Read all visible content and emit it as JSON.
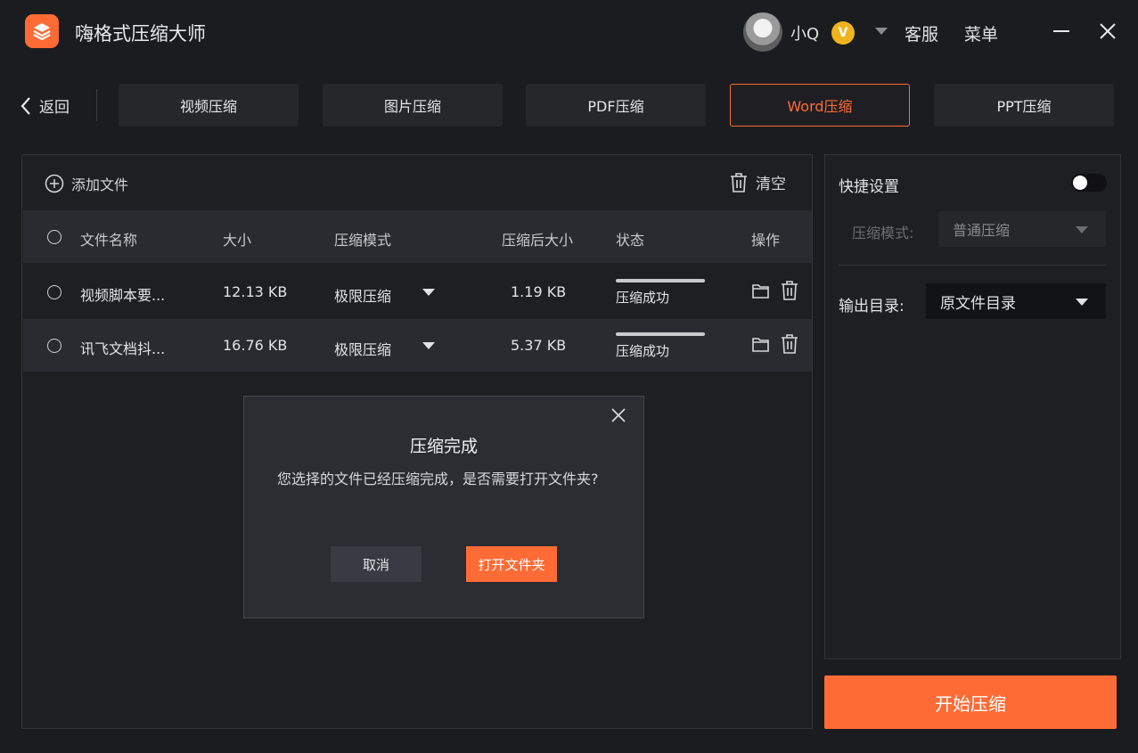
{
  "app": {
    "title": "嗨格式压缩大师",
    "accent": "#ff6b35"
  },
  "user": {
    "name": "小Q",
    "vip_badge": "V"
  },
  "topnav": {
    "service": "客服",
    "menu": "菜单"
  },
  "back": {
    "label": "返回"
  },
  "tabs": [
    {
      "label": "视频压缩"
    },
    {
      "label": "图片压缩"
    },
    {
      "label": "PDF压缩"
    },
    {
      "label": "Word压缩"
    },
    {
      "label": "PPT压缩"
    }
  ],
  "active_tab": "Word压缩",
  "filelist": {
    "add_file": "添加文件",
    "clear": "清空",
    "columns": {
      "name": "文件名称",
      "size": "大小",
      "mode": "压缩模式",
      "after": "压缩后大小",
      "status": "状态",
      "ops": "操作"
    },
    "rows": [
      {
        "name": "视频脚本要...",
        "size": "12.13 KB",
        "mode": "极限压缩",
        "after": "1.19 KB",
        "status": "压缩成功",
        "progress": 1.0
      },
      {
        "name": "讯飞文档抖...",
        "size": "16.76 KB",
        "mode": "极限压缩",
        "after": "5.37 KB",
        "status": "压缩成功",
        "progress": 1.0
      }
    ]
  },
  "settings": {
    "quick_label": "快捷设置",
    "quick_enabled": false,
    "mode_label": "压缩模式:",
    "mode_value": "普通压缩",
    "output_label": "输出目录:",
    "output_value": "原文件目录",
    "start_button": "开始压缩"
  },
  "dialog": {
    "title": "压缩完成",
    "message": "您选择的文件已经压缩完成，是否需要打开文件夹?",
    "cancel": "取消",
    "open": "打开文件夹"
  }
}
